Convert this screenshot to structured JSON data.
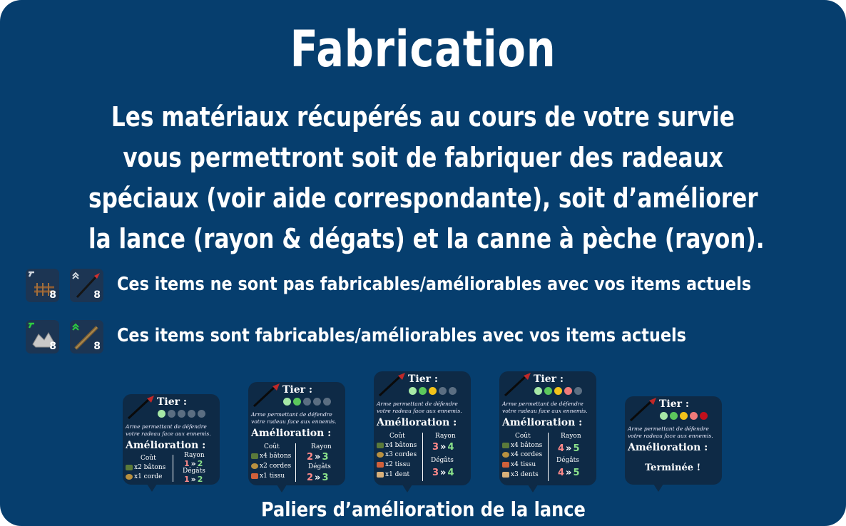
{
  "title": "Fabrication",
  "description": [
    "Les matériaux récupérés au cours de votre survie",
    "vous permettront soit de fabriquer des radeaux",
    "spéciaux (voir aide correspondante), soit d’améliorer",
    "la lance (rayon & dégats) et la canne à pèche (rayon)."
  ],
  "legend": {
    "unavailable": {
      "text": "Ces items ne sont pas fabricables/améliorables avec vos items actuels",
      "counts": [
        "8",
        "8"
      ],
      "icon_color": "#cfd6de"
    },
    "available": {
      "text": "Ces items sont fabricables/améliorables avec vos items actuels",
      "counts": [
        "8",
        "8"
      ],
      "icon_color": "#2ecc40"
    }
  },
  "cards": [
    {
      "tier_label": "Tier :",
      "dots": [
        "#a6e8a6",
        "#5b6e82",
        "#5b6e82",
        "#5b6e82",
        "#5b6e82"
      ],
      "desc": [
        "Arme permettant de défendre",
        "votre radeau face aux ennemis."
      ],
      "amel_label": "Amélioration :",
      "cost_label": "Coût",
      "rayon_label": "Rayon",
      "degats_label": "Dégâts",
      "materials": [
        "x2 bâtons",
        "x1 corde"
      ],
      "rayon": [
        "1",
        "2"
      ],
      "degats": [
        "1",
        "2"
      ]
    },
    {
      "tier_label": "Tier :",
      "dots": [
        "#a6e8a6",
        "#5cc85c",
        "#5b6e82",
        "#5b6e82",
        "#5b6e82"
      ],
      "desc": [
        "Arme permettant de défendre",
        "votre radeau face aux ennemis."
      ],
      "amel_label": "Amélioration :",
      "cost_label": "Coût",
      "rayon_label": "Rayon",
      "degats_label": "Dégâts",
      "materials": [
        "x4 bâtons",
        "x2 cordes",
        "x1 tissu"
      ],
      "rayon": [
        "2",
        "3"
      ],
      "degats": [
        "2",
        "3"
      ]
    },
    {
      "tier_label": "Tier :",
      "dots": [
        "#a6e8a6",
        "#5cc85c",
        "#f2c21a",
        "#5b6e82",
        "#5b6e82"
      ],
      "desc": [
        "Arme permettant de défendre",
        "votre radeau face aux ennemis."
      ],
      "amel_label": "Amélioration :",
      "cost_label": "Coût",
      "rayon_label": "Rayon",
      "degats_label": "Dégâts",
      "materials": [
        "x4 bâtons",
        "x3 cordes",
        "x2 tissu",
        "x1 dent"
      ],
      "rayon": [
        "3",
        "4"
      ],
      "degats": [
        "3",
        "4"
      ]
    },
    {
      "tier_label": "Tier :",
      "dots": [
        "#a6e8a6",
        "#5cc85c",
        "#f2c21a",
        "#f07a7a",
        "#5b6e82"
      ],
      "desc": [
        "Arme permettant de défendre",
        "votre radeau face aux ennemis."
      ],
      "amel_label": "Amélioration :",
      "cost_label": "Coût",
      "rayon_label": "Rayon",
      "degats_label": "Dégâts",
      "materials": [
        "x4 bâtons",
        "x4 cordes",
        "x4 tissu",
        "x3 dents"
      ],
      "rayon": [
        "4",
        "5"
      ],
      "degats": [
        "4",
        "5"
      ]
    },
    {
      "tier_label": "Tier :",
      "dots": [
        "#a6e8a6",
        "#5cc85c",
        "#f2c21a",
        "#f07a7a",
        "#c0101c"
      ],
      "desc": [
        "Arme permettant de défendre",
        "votre radeau face aux ennemis."
      ],
      "amel_label": "Amélioration :",
      "done_label": "Terminée !"
    }
  ],
  "footer": "Paliers d’amélioration de la lance",
  "colors": {
    "panel": "#063e6e",
    "card": "#0e2a46",
    "old_value": "#ff8a8a",
    "new_value": "#8be28b"
  }
}
